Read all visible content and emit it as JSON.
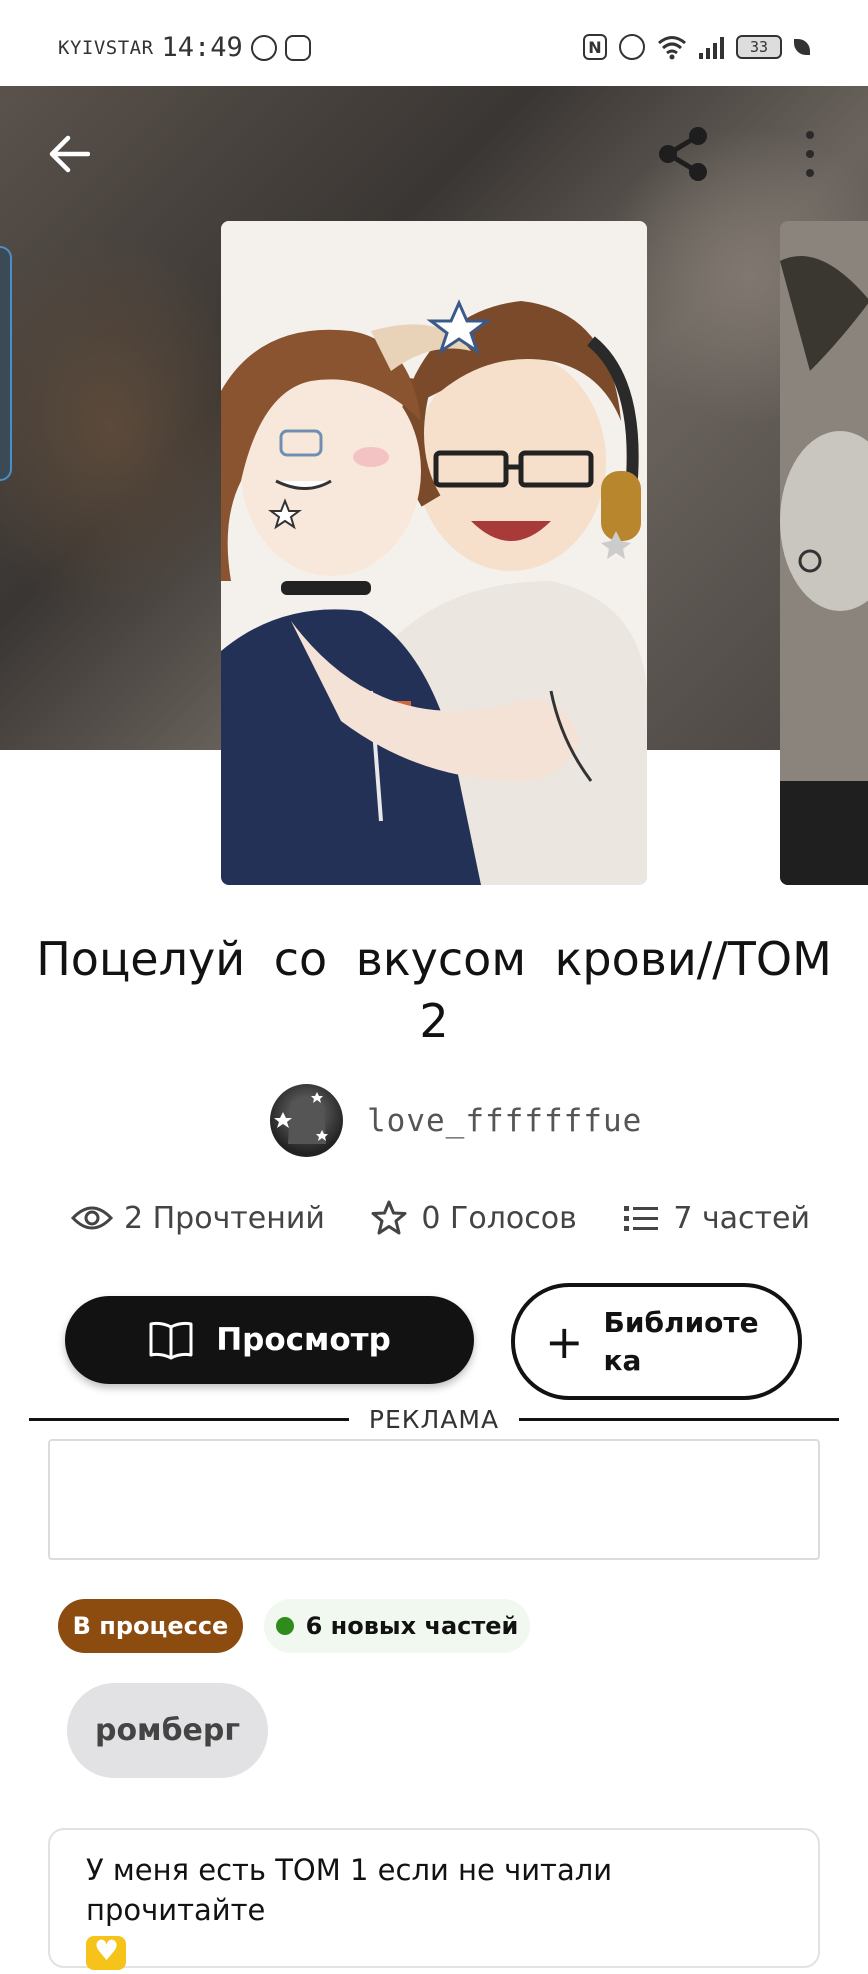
{
  "status_bar": {
    "carrier": "KYIVSTAR",
    "time": "14:49",
    "battery": "33",
    "nfc": "N"
  },
  "header": {
    "back_icon": "arrow-left-icon",
    "share_icon": "share-icon",
    "more_icon": "more-vertical-icon"
  },
  "story": {
    "title": "Поцелуй со вкусом крови//ТОМ 2",
    "author": "love_fffffffue"
  },
  "stats": {
    "reads": "2 Прочтений",
    "votes": "0 Голосов",
    "parts": "7 частей"
  },
  "actions": {
    "read_label": "Просмотр",
    "library_label": "Библиотека",
    "library_icon": "plus-icon",
    "read_icon": "book-open-icon"
  },
  "ad": {
    "label": "РЕКЛАМА"
  },
  "badges": {
    "status": "В процессе",
    "new_parts": "6 новых частей",
    "status_color": "#8c4c10",
    "new_dot_color": "#2f8c1c"
  },
  "tags": [
    "ромберг"
  ],
  "description": {
    "text": "У меня есть ТОМ 1 если не читали прочитайте"
  },
  "colors": {
    "primary": "#121212",
    "tag_bg": "#e2e1e3"
  }
}
